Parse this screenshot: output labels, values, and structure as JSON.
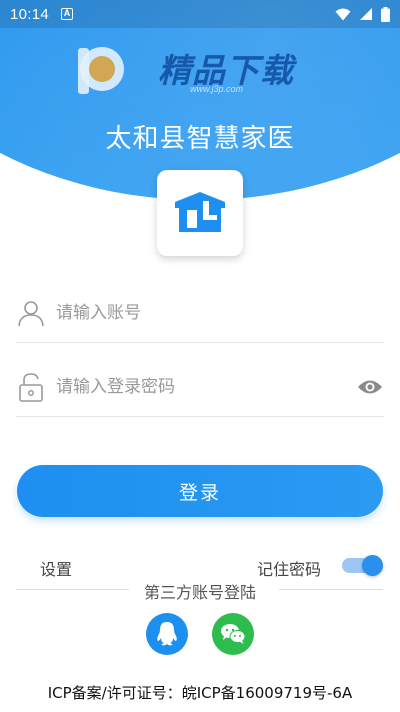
{
  "status_bar": {
    "time": "10:14",
    "notification_letter": "A",
    "icons": [
      "wifi-icon",
      "signal-icon",
      "battery-icon"
    ]
  },
  "watermark": {
    "text": "精品下载",
    "url": "www.j3p.com"
  },
  "header": {
    "app_title": "太和县智慧家医"
  },
  "login_form": {
    "account_placeholder": "请输入账号",
    "password_placeholder": "请输入登录密码",
    "login_button": "登录"
  },
  "options": {
    "settings_label": "设置",
    "remember_password_label": "记住密码",
    "remember_password_on": true
  },
  "third_party": {
    "label": "第三方账号登陆",
    "providers": [
      "qq-icon",
      "wechat-icon"
    ]
  },
  "footer": {
    "icp_text": "ICP备案/许可证号：皖ICP备16009719号-6A"
  },
  "colors": {
    "primary": "#1e8ff0",
    "wechat": "#2dbd4e"
  }
}
